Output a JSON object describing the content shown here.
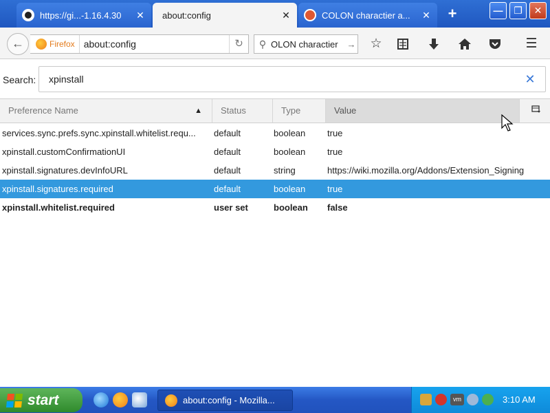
{
  "tabs": [
    {
      "title": "https://gi...-1.16.4.30",
      "icon": "github-icon",
      "active": false
    },
    {
      "title": "about:config",
      "icon": "",
      "active": true
    },
    {
      "title": "COLON charactier a...",
      "icon": "duckduckgo-icon",
      "active": false
    }
  ],
  "tab_close_glyph": "✕",
  "new_tab_glyph": "+",
  "window_controls": {
    "minimize": "—",
    "maximize": "❐",
    "close": "✕"
  },
  "navbar": {
    "identity_label": "Firefox",
    "url": "about:config",
    "search_text": "OLON charactier",
    "icons": [
      "back-arrow-icon",
      "reload-icon",
      "bookmark-star-icon",
      "reading-list-icon",
      "download-icon",
      "home-icon",
      "pocket-icon",
      "menu-icon"
    ]
  },
  "config_search": {
    "label": "Search:",
    "value": "xpinstall",
    "clear_glyph": "✕"
  },
  "columns": {
    "name": "Preference Name",
    "status": "Status",
    "type": "Type",
    "value": "Value"
  },
  "rows": [
    {
      "name": "services.sync.prefs.sync.xpinstall.whitelist.requ...",
      "status": "default",
      "type": "boolean",
      "value": "true",
      "selected": false,
      "modified": false
    },
    {
      "name": "xpinstall.customConfirmationUI",
      "status": "default",
      "type": "boolean",
      "value": "true",
      "selected": false,
      "modified": false
    },
    {
      "name": "xpinstall.signatures.devInfoURL",
      "status": "default",
      "type": "string",
      "value": "https://wiki.mozilla.org/Addons/Extension_Signing",
      "selected": false,
      "modified": false
    },
    {
      "name": "xpinstall.signatures.required",
      "status": "default",
      "type": "boolean",
      "value": "true",
      "selected": true,
      "modified": false
    },
    {
      "name": "xpinstall.whitelist.required",
      "status": "user set",
      "type": "boolean",
      "value": "false",
      "selected": false,
      "modified": true
    }
  ],
  "taskbar": {
    "start_label": "start",
    "task_label": "about:config - Mozilla...",
    "clock": "3:10 AM",
    "quicklaunch_icons": [
      "internet-explorer-icon",
      "firefox-icon",
      "settings-icon"
    ],
    "tray_icons": [
      "network-icon",
      "shield-icon",
      "vm-icon",
      "sync-icon",
      "update-icon"
    ]
  },
  "colors": {
    "selection": "#3399de",
    "titlebar": "#1f57c0",
    "taskbar": "#2457c4",
    "start": "#3a9436",
    "tray": "#0e8ad9"
  }
}
